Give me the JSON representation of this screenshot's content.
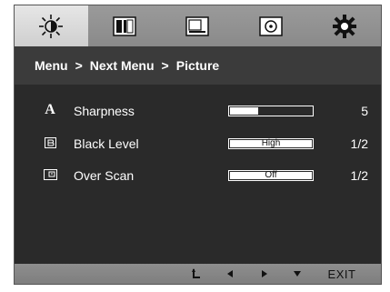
{
  "tabs": [
    {
      "icon": "brightness-icon",
      "active": true
    },
    {
      "icon": "contrast-icon",
      "active": false
    },
    {
      "icon": "screen-icon",
      "active": false
    },
    {
      "icon": "disc-icon",
      "active": false
    },
    {
      "icon": "gear-icon",
      "active": false
    }
  ],
  "breadcrumb": {
    "item1": "Menu",
    "sep1": ">",
    "item2": "Next Menu",
    "sep2": ">",
    "item3": "Picture"
  },
  "settings": [
    {
      "icon": "sharpness-icon",
      "icon_glyph": "A",
      "label": "Sharpness",
      "control": "slider",
      "level": 0.36,
      "value": "5"
    },
    {
      "icon": "black-level-icon",
      "label": "Black Level",
      "control": "select",
      "selected": "High",
      "value": "1/2"
    },
    {
      "icon": "over-scan-icon",
      "label": "Over Scan",
      "control": "select",
      "selected": "Off",
      "value": "1/2"
    }
  ],
  "bottom_nav": {
    "back_icon": "back-arrow-icon",
    "left_icon": "left-arrow-icon",
    "right_icon": "right-arrow-icon",
    "down_icon": "down-arrow-icon",
    "exit_label": "EXIT"
  },
  "colors": {
    "tabbar": "#8f8f8f",
    "active_tab": "#dcdcdc",
    "breadcrumb_bg": "#3b3b3b",
    "menu_bg": "#2a2a2a",
    "text": "#ffffff"
  }
}
